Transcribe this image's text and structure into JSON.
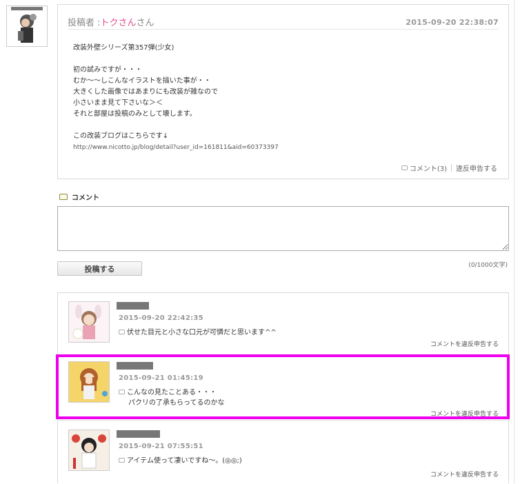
{
  "post": {
    "poster_prefix": "投稿者 :",
    "poster_name": "トクさん",
    "poster_suffix": "さん",
    "date": "2015-09-20 22:38:07",
    "body_lines": [
      "改装外壁シリーズ第357弾(少女)",
      "",
      "初の試みですが・・・",
      "むか～～しこんなイラストを描いた事が・・",
      "大きくした画像ではあまりにも改装が雑なので",
      "小さいまま見て下さいな＞＜",
      "それと部屋は投稿のみとして壊します。",
      "",
      "この改装ブログはこちらです↓"
    ],
    "url": "http://www.nicotto.jp/blog/detail?user_id=161811&aid=60373397",
    "comment_link": "コメント(3)",
    "report_link": "違反申告する"
  },
  "comment_form": {
    "label": "コメント",
    "textarea_value": "",
    "char_count": "(0/1000文字)",
    "submit_label": "投稿する"
  },
  "comments": [
    {
      "date": "2015-09-20 22:42:35",
      "lines": [
        "伏せた目元と小さな口元が可憐だと思います^^",
        ""
      ],
      "report": "コメントを違反申告する"
    },
    {
      "date": "2015-09-21 01:45:19",
      "lines": [
        "こんなの見たことある・・・",
        "パクリの了承もらってるのかな"
      ],
      "report": "コメントを違反申告する"
    },
    {
      "date": "2015-09-21 07:55:51",
      "lines": [
        "アイテム使って凄いですね～。(◎◎;)",
        ""
      ],
      "report": "コメントを違反申告する"
    }
  ],
  "colors": {
    "poster_name": "#e04d8f",
    "highlight": "#ee00ee",
    "date": "#999999"
  },
  "icons": [
    "comment-bubble-icon",
    "comment-label-icon",
    "resize-grip-icon"
  ]
}
